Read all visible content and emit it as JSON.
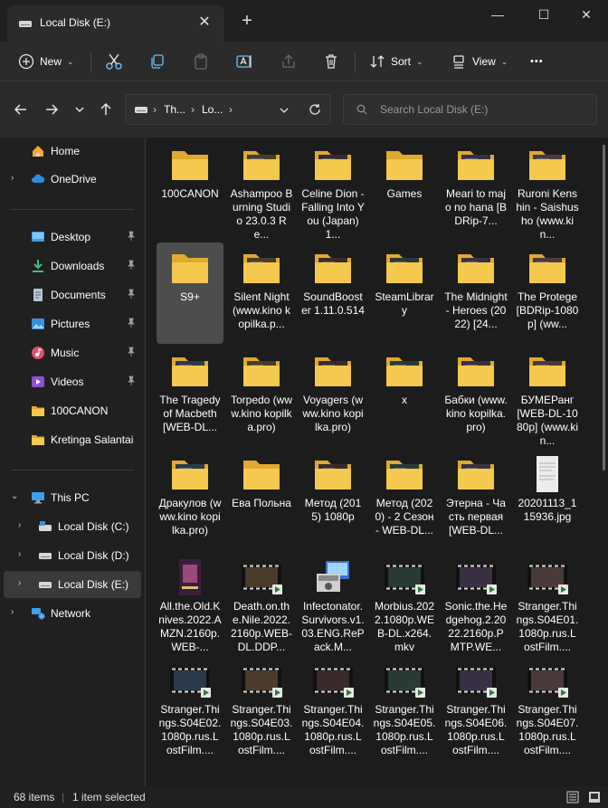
{
  "window": {
    "tab_title": "Local Disk (E:)",
    "new_tab_symbol": "+",
    "close_tab_symbol": "✕",
    "minimize_symbol": "—",
    "maximize_symbol": "☐",
    "close_symbol": "✕"
  },
  "toolbar": {
    "new_label": "New",
    "sort_label": "Sort",
    "view_label": "View",
    "more_symbol": "•••"
  },
  "address": {
    "crumbs": [
      "Th...",
      "Lo..."
    ],
    "search_placeholder": "Search Local Disk (E:)"
  },
  "sidebar": {
    "items": [
      {
        "label": "Home",
        "icon": "home-icon"
      },
      {
        "label": "OneDrive",
        "icon": "cloud-icon"
      },
      {
        "label": "Desktop",
        "icon": "desktop-icon",
        "pinned": true
      },
      {
        "label": "Downloads",
        "icon": "download-icon",
        "pinned": true
      },
      {
        "label": "Documents",
        "icon": "document-icon",
        "pinned": true
      },
      {
        "label": "Pictures",
        "icon": "picture-icon",
        "pinned": true
      },
      {
        "label": "Music",
        "icon": "music-icon",
        "pinned": true
      },
      {
        "label": "Videos",
        "icon": "video-icon",
        "pinned": true
      },
      {
        "label": "100CANON",
        "icon": "folder-icon"
      },
      {
        "label": "Kretinga Salantai",
        "icon": "folder-icon"
      },
      {
        "label": "This PC",
        "icon": "pc-icon"
      },
      {
        "label": "Local Disk (C:)",
        "icon": "drive-icon"
      },
      {
        "label": "Local Disk (D:)",
        "icon": "drive-icon"
      },
      {
        "label": "Local Disk (E:)",
        "icon": "drive-icon"
      },
      {
        "label": "Network",
        "icon": "network-icon"
      }
    ]
  },
  "files": [
    {
      "name": "100CANON",
      "type": "folder"
    },
    {
      "name": "Ashampoo Burning Studio 23.0.3 Re...",
      "type": "folder-img"
    },
    {
      "name": "Celine Dion - Falling Into You (Japan) 1...",
      "type": "folder-img"
    },
    {
      "name": "Games",
      "type": "folder"
    },
    {
      "name": "Meari to majo no hana [BDRip-7...",
      "type": "folder-img"
    },
    {
      "name": "Ruroni Kenshin - Saishusho (www.kin...",
      "type": "folder-img"
    },
    {
      "name": "S9+",
      "type": "folder",
      "selected": true
    },
    {
      "name": "Silent Night (www.kino kopilka.p...",
      "type": "folder-img"
    },
    {
      "name": "SoundBooster 1.11.0.514",
      "type": "folder-img"
    },
    {
      "name": "SteamLibrary",
      "type": "folder-img"
    },
    {
      "name": "The Midnight - Heroes (2022) [24...",
      "type": "folder-img"
    },
    {
      "name": "The Protege [BDRip-1080p] (ww...",
      "type": "folder-img"
    },
    {
      "name": "The Tragedy of Macbeth [WEB-DL...",
      "type": "folder-img"
    },
    {
      "name": "Torpedo (www.kino kopilka.pro)",
      "type": "folder-img"
    },
    {
      "name": "Voyagers (www.kino kopilka.pro)",
      "type": "folder-img"
    },
    {
      "name": "x",
      "type": "folder-img"
    },
    {
      "name": "Бабки (www.kino kopilka.pro)",
      "type": "folder-img"
    },
    {
      "name": "БУМЕРанг [WEB-DL-1080p] (www.kin...",
      "type": "folder-img"
    },
    {
      "name": "Дракулов (www.kino kopilka.pro)",
      "type": "folder-img"
    },
    {
      "name": "Ева Польна",
      "type": "folder"
    },
    {
      "name": "Метод (2015) 1080p",
      "type": "folder-img"
    },
    {
      "name": "Метод (2020) - 2 Сезон - WEB-DL...",
      "type": "folder-img"
    },
    {
      "name": "Этерна - Часть первая [WEB-DL...",
      "type": "folder-img"
    },
    {
      "name": "20201113_115936.jpg",
      "type": "image"
    },
    {
      "name": "All.the.Old.Knives.2022.AMZN.2160p.WEB-...",
      "type": "poster"
    },
    {
      "name": "Death.on.the.Nile.2022.2160p.WEB-DL.DDP...",
      "type": "video"
    },
    {
      "name": "Infectonator.Survivors.v1.03.ENG.RePack.M...",
      "type": "installer"
    },
    {
      "name": "Morbius.2022.1080p.WEB-DL.x264.mkv",
      "type": "video"
    },
    {
      "name": "Sonic.the.Hedgehog.2.2022.2160p.PMTP.WE...",
      "type": "video"
    },
    {
      "name": "Stranger.Things.S04E01.1080p.rus.LostFilm....",
      "type": "video"
    },
    {
      "name": "Stranger.Things.S04E02.1080p.rus.LostFilm....",
      "type": "video"
    },
    {
      "name": "Stranger.Things.S04E03.1080p.rus.LostFilm....",
      "type": "video"
    },
    {
      "name": "Stranger.Things.S04E04.1080p.rus.LostFilm....",
      "type": "video"
    },
    {
      "name": "Stranger.Things.S04E05.1080p.rus.LostFilm....",
      "type": "video"
    },
    {
      "name": "Stranger.Things.S04E06.1080p.rus.LostFilm....",
      "type": "video"
    },
    {
      "name": "Stranger.Things.S04E07.1080p.rus.LostFilm....",
      "type": "video"
    }
  ],
  "status": {
    "items_count": "68 items",
    "selection": "1 item selected"
  },
  "colors": {
    "folder": "#f4c94e",
    "folder_dark": "#e0a92f",
    "accent": "#4cc2ff"
  }
}
